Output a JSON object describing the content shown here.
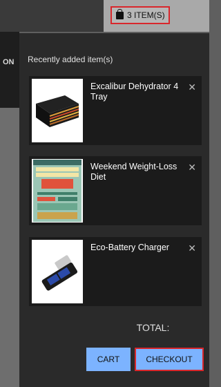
{
  "header": {
    "cart_count_label": "3 ITEM(S)",
    "nav_fragment": "ON"
  },
  "minicart": {
    "heading": "Recently added item(s)",
    "items": [
      {
        "name": "Excalibur Dehydrator 4 Tray",
        "remove_label": "✕",
        "thumb_icon": "food-dehydrator-image"
      },
      {
        "name": "Weekend Weight-Loss Diet",
        "remove_label": "✕",
        "thumb_icon": "book-cover-image"
      },
      {
        "name": "Eco-Battery Charger",
        "remove_label": "✕",
        "thumb_icon": "battery-charger-image"
      }
    ],
    "total_label": "TOTAL:",
    "cart_button_label": "CART",
    "checkout_button_label": "CHECKOUT"
  },
  "colors": {
    "accent_button": "#7cb3ff",
    "highlight_border": "#d9262b",
    "panel_bg": "#2a2a2a"
  }
}
